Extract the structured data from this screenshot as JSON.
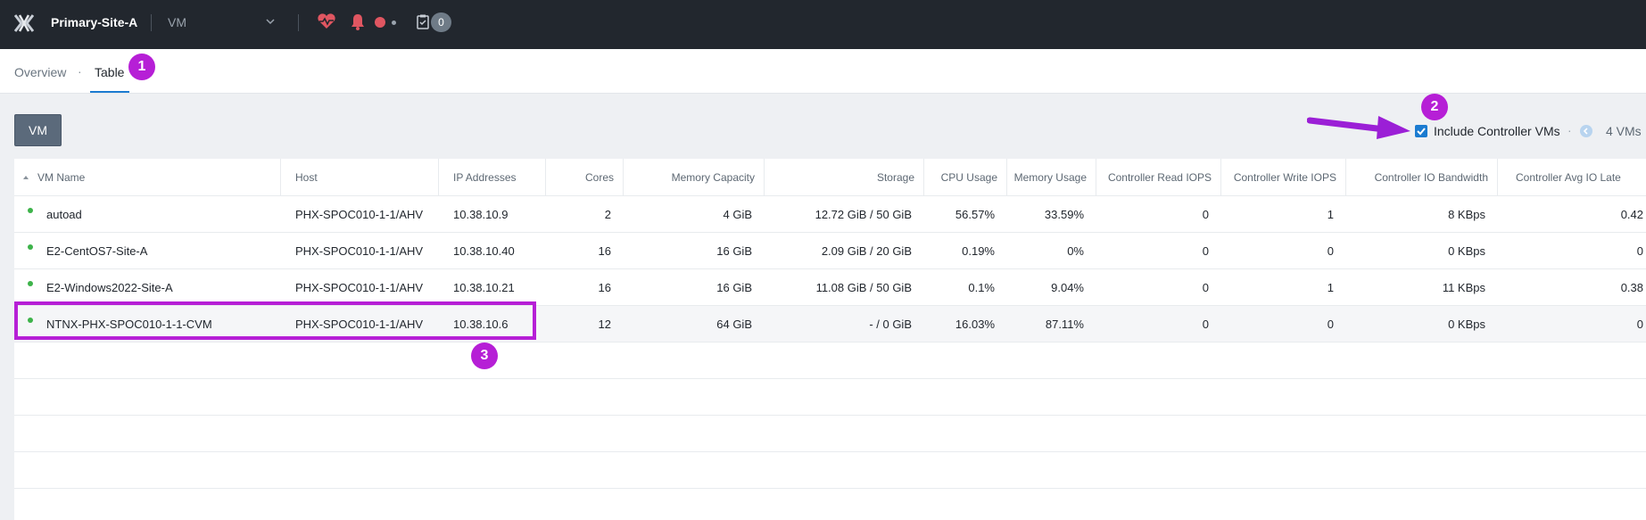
{
  "topbar": {
    "site_name": "Primary-Site-A",
    "entity_select": "VM",
    "task_count": "0"
  },
  "tabs": {
    "overview": "Overview",
    "separator": "·",
    "table": "Table"
  },
  "callouts": [
    "1",
    "2",
    "3"
  ],
  "toolbar": {
    "vm_button": "VM",
    "include_cvm_label": "Include Controller VMs",
    "include_cvm_checked": true,
    "separator": "·",
    "vm_count": "4 VMs"
  },
  "table": {
    "columns": [
      "VM Name",
      "Host",
      "IP Addresses",
      "Cores",
      "Memory Capacity",
      "Storage",
      "CPU Usage",
      "Memory Usage",
      "Controller Read IOPS",
      "Controller Write IOPS",
      "Controller IO Bandwidth",
      "Controller Avg IO Late"
    ],
    "rows": [
      {
        "name": "autoad",
        "host": "PHX-SPOC010-1-1/AHV",
        "ip": "10.38.10.9",
        "cores": "2",
        "memory": "4 GiB",
        "storage": "12.72 GiB / 50 GiB",
        "cpu": "56.57%",
        "mem_usage": "33.59%",
        "read_iops": "0",
        "write_iops": "1",
        "bandwidth": "8 KBps",
        "latency": "0.42"
      },
      {
        "name": "E2-CentOS7-Site-A",
        "host": "PHX-SPOC010-1-1/AHV",
        "ip": "10.38.10.40",
        "cores": "16",
        "memory": "16 GiB",
        "storage": "2.09 GiB / 20 GiB",
        "cpu": "0.19%",
        "mem_usage": "0%",
        "read_iops": "0",
        "write_iops": "0",
        "bandwidth": "0 KBps",
        "latency": "0"
      },
      {
        "name": "E2-Windows2022-Site-A",
        "host": "PHX-SPOC010-1-1/AHV",
        "ip": "10.38.10.21",
        "cores": "16",
        "memory": "16 GiB",
        "storage": "11.08 GiB / 50 GiB",
        "cpu": "0.1%",
        "mem_usage": "9.04%",
        "read_iops": "0",
        "write_iops": "1",
        "bandwidth": "11 KBps",
        "latency": "0.38"
      },
      {
        "name": "NTNX-PHX-SPOC010-1-1-CVM",
        "host": "PHX-SPOC010-1-1/AHV",
        "ip": "10.38.10.6",
        "cores": "12",
        "memory": "64 GiB",
        "storage": "- / 0 GiB",
        "cpu": "16.03%",
        "mem_usage": "87.11%",
        "read_iops": "0",
        "write_iops": "0",
        "bandwidth": "0 KBps",
        "latency": "0"
      }
    ]
  },
  "colors": {
    "topbar_bg": "#22272e",
    "accent_blue": "#1b7bd0",
    "annotation_purple": "#b61fd6",
    "status_green": "#3db34a",
    "alert_red": "#e05661"
  }
}
